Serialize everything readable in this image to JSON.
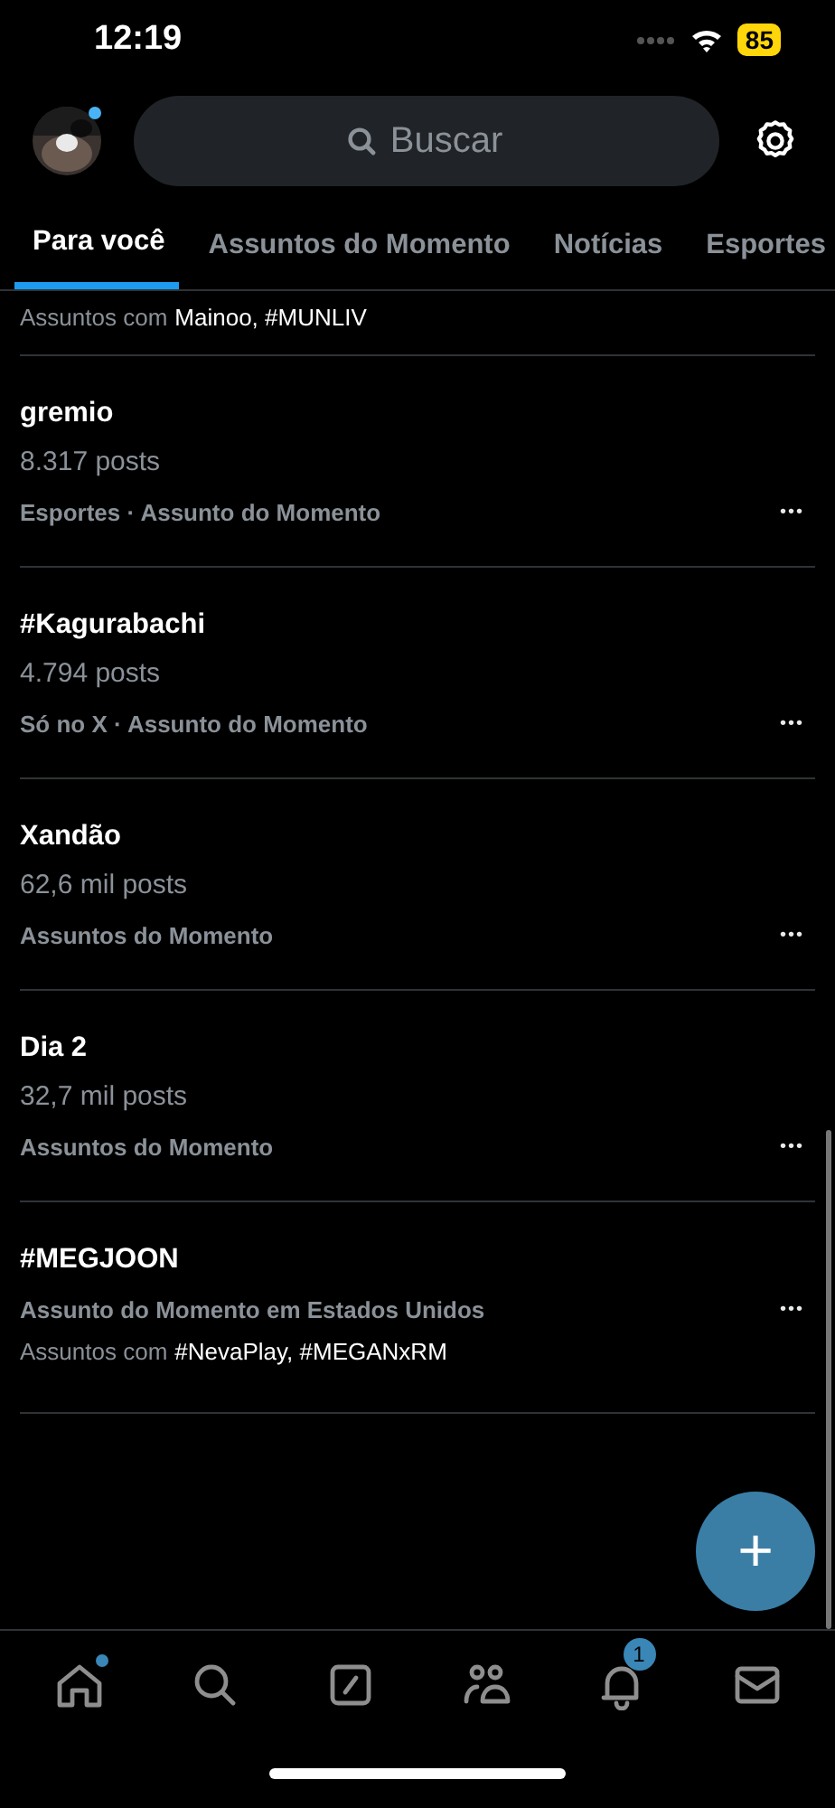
{
  "status_bar": {
    "time": "12:19",
    "battery": "85"
  },
  "header": {
    "search": {
      "placeholder": "Buscar"
    },
    "avatar": {
      "kind": "picture",
      "notification_dot": true
    }
  },
  "tabs": [
    {
      "label": "Para você",
      "selected": true
    },
    {
      "label": "Assuntos do Momento",
      "selected": false
    },
    {
      "label": "Notícias",
      "selected": false
    },
    {
      "label": "Esportes",
      "selected": false
    }
  ],
  "partial_line": {
    "prefix": "Assuntos com",
    "tags": "Mainoo, #MUNLIV"
  },
  "trends": [
    {
      "title": "gremio",
      "count": "8.317 posts",
      "meta": "Esportes · Assunto do Momento",
      "more": "•••"
    },
    {
      "title": "#Kagurabachi",
      "count": "4.794 posts",
      "meta": "Só no X · Assunto do Momento",
      "more": "•••"
    },
    {
      "title": "Xandão",
      "count": "62,6 mil posts",
      "meta": "Assuntos do Momento",
      "more": "•••"
    },
    {
      "title": "Dia 2",
      "count": "32,7 mil posts",
      "meta": "Assuntos do Momento",
      "more": "•••"
    },
    {
      "title": "#MEGJOON",
      "meta": "Assunto do Momento em Estados Unidos",
      "related": {
        "prefix": "Assuntos com",
        "tags": "#NevaPlay, #MEGANxRM"
      },
      "more": "•••"
    }
  ],
  "fab": {
    "label": "+"
  },
  "nav": [
    {
      "kind": "home",
      "selected": false,
      "dot": true
    },
    {
      "kind": "search",
      "selected": false
    },
    {
      "kind": "compose",
      "selected": false
    },
    {
      "kind": "people",
      "selected": false
    },
    {
      "kind": "bell",
      "selected": false,
      "badge": "1"
    },
    {
      "kind": "mail",
      "selected": false
    }
  ]
}
